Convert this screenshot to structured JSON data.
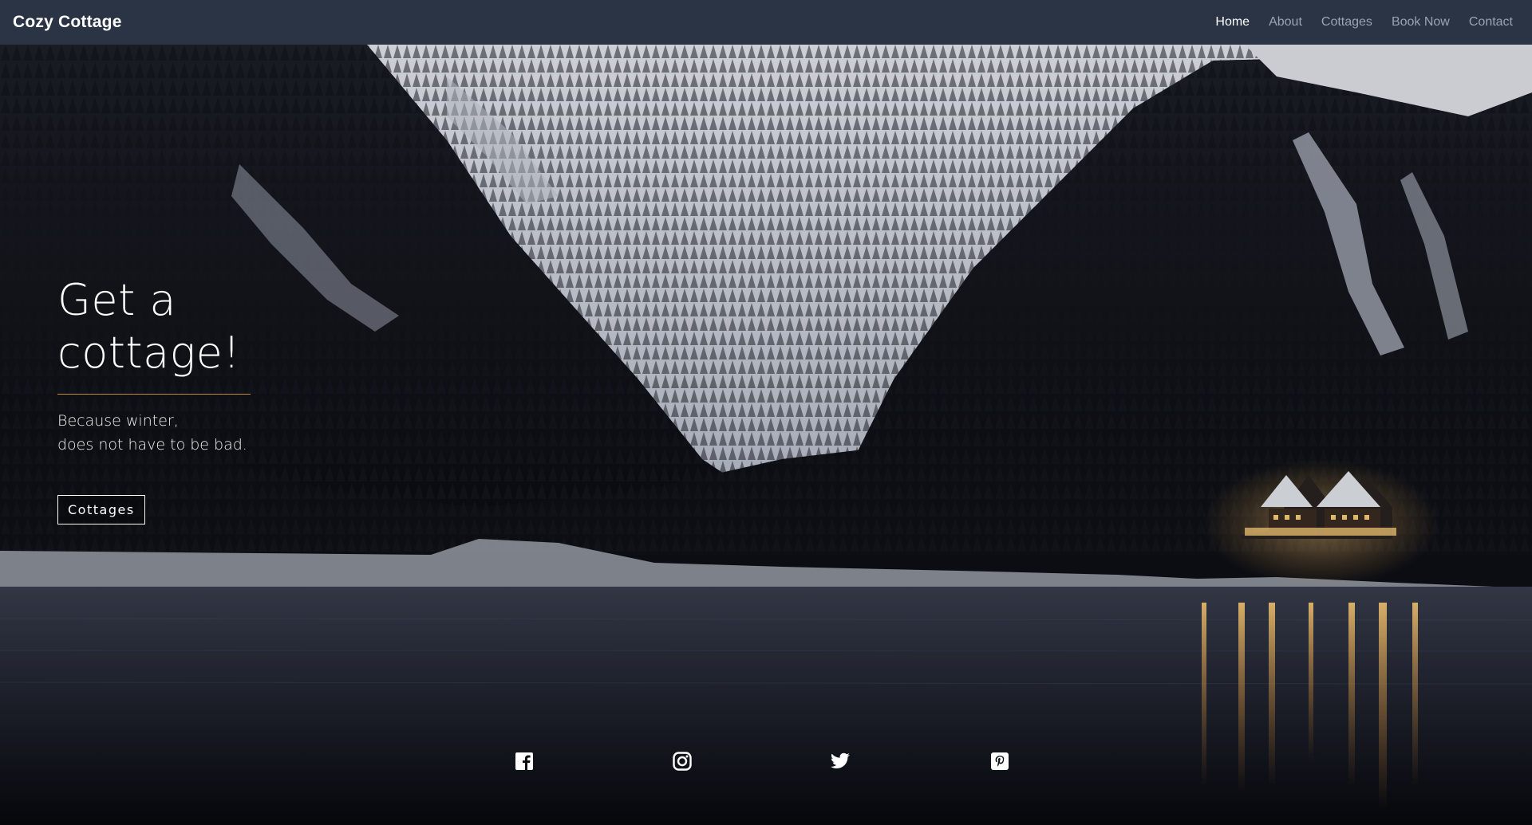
{
  "navbar": {
    "brand": "Cozy Cottage",
    "links": [
      {
        "label": "Home",
        "active": true
      },
      {
        "label": "About",
        "active": false
      },
      {
        "label": "Cottages",
        "active": false
      },
      {
        "label": "Book Now",
        "active": false
      },
      {
        "label": "Contact",
        "active": false
      }
    ]
  },
  "hero": {
    "title": "Get a cottage!",
    "subtitle_line1": "Because winter,",
    "subtitle_line2": "does not have to be bad.",
    "button_label": "Cottages",
    "background_image": "snowy mountain forest with lit cottage by a lake at night"
  },
  "social": [
    {
      "name": "facebook-icon"
    },
    {
      "name": "instagram-icon"
    },
    {
      "name": "twitter-icon"
    },
    {
      "name": "pinterest-icon"
    }
  ],
  "colors": {
    "navbar_bg": "#2b3445",
    "nav_active": "#ffffff",
    "nav_inactive": "#9aa3b2",
    "accent_rule": "#c58a3b"
  }
}
